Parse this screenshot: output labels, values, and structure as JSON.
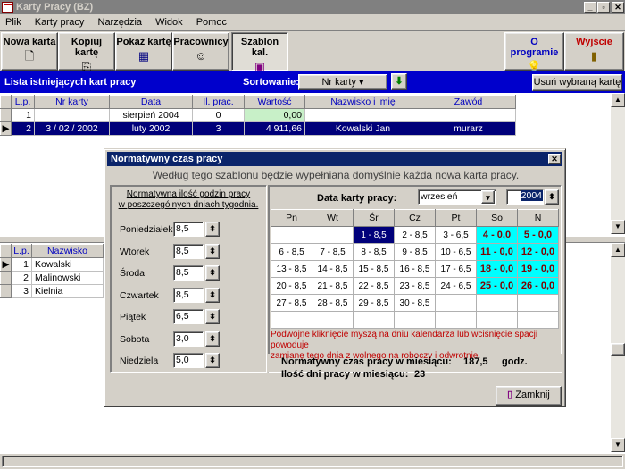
{
  "window": {
    "title": "Karty Pracy (BZ)"
  },
  "menu": [
    "Plik",
    "Karty pracy",
    "Narzędzia",
    "Widok",
    "Pomoc"
  ],
  "toolbar": {
    "new_card": "Nowa karta",
    "copy_card": "Kopiuj kartę",
    "show_card": "Pokaż kartę",
    "employees": "Pracownicy",
    "template": "Szablon kal.",
    "about": "O programie",
    "exit": "Wyjście"
  },
  "list_header": {
    "title": "Lista istniejących kart pracy",
    "sort_label": "Sortowanie:",
    "sort_value": "Nr karty",
    "delete_button": "Usuń wybraną kartę"
  },
  "cards_table": {
    "columns": [
      "L.p.",
      "Nr karty",
      "Data",
      "Il. prac.",
      "Wartość",
      "Nazwisko i imię",
      "Zawód"
    ],
    "rows": [
      [
        "1",
        "",
        "sierpień 2004",
        "0",
        "0,00",
        "",
        ""
      ],
      [
        "2",
        "3 / 02 / 2002",
        "luty 2002",
        "3",
        "4 911,66",
        "Kowalski Jan",
        "murarz"
      ]
    ]
  },
  "employees_table": {
    "columns": [
      "L.p.",
      "Nazwisko"
    ],
    "rows": [
      [
        "1",
        "Kowalski"
      ],
      [
        "2",
        "Malinowski"
      ],
      [
        "3",
        "Kielnia"
      ]
    ]
  },
  "dialog": {
    "title": "Normatywny czas pracy",
    "subtitle": "Według tego szablonu będzie wypełniana domyślnie każda nowa karta pracy.",
    "norm_heading_1": "Normatywna ilość godzin pracy",
    "norm_heading_2": "w poszczególnych dniach tygodnia.",
    "weekdays": [
      {
        "label": "Poniedziałek",
        "value": "8,5"
      },
      {
        "label": "Wtorek",
        "value": "8,5"
      },
      {
        "label": "Środa",
        "value": "8,5"
      },
      {
        "label": "Czwartek",
        "value": "8,5"
      },
      {
        "label": "Piątek",
        "value": "6,5"
      },
      {
        "label": "Sobota",
        "value": "3,0"
      },
      {
        "label": "Niedziela",
        "value": "5,0"
      }
    ],
    "date_label": "Data karty pracy:",
    "month": "wrzesień",
    "year": "2004",
    "calendar_headers": [
      "Pn",
      "Wt",
      "Śr",
      "Cz",
      "Pt",
      "So",
      "N"
    ],
    "calendar": [
      [
        "",
        "",
        "1 - 8,5",
        "2 - 8,5",
        "3 - 6,5",
        "4 - 0,0",
        "5 - 0,0"
      ],
      [
        "6 - 8,5",
        "7 - 8,5",
        "8 - 8,5",
        "9 - 8,5",
        "10 - 6,5",
        "11 - 0,0",
        "12 - 0,0"
      ],
      [
        "13 - 8,5",
        "14 - 8,5",
        "15 - 8,5",
        "16 - 8,5",
        "17 - 6,5",
        "18 - 0,0",
        "19 - 0,0"
      ],
      [
        "20 - 8,5",
        "21 - 8,5",
        "22 - 8,5",
        "23 - 8,5",
        "24 - 6,5",
        "25 - 0,0",
        "26 - 0,0"
      ],
      [
        "27 - 8,5",
        "28 - 8,5",
        "29 - 8,5",
        "30 - 8,5",
        "",
        "",
        ""
      ],
      [
        "",
        "",
        "",
        "",
        "",
        "",
        ""
      ]
    ],
    "hint_1": "Podwójne kliknięcie myszą na dniu kalendarza lub wciśnięcie spacji  powoduje",
    "hint_2": "zamianę  tego dnia z wolnego na roboczy i odwrotnie.",
    "monthly_hours_label": "Normatywny czas pracy w miesiącu:",
    "monthly_hours_value": "187,5",
    "monthly_hours_unit": "godz.",
    "work_days_label": "Ilość dni pracy w miesiącu:",
    "work_days_value": "23",
    "close_button": "Zamknij"
  },
  "colors": {
    "accent_blue": "#0000cc",
    "selection": "#00007a",
    "free_day": "#00ffff",
    "hint_text": "#c00000"
  }
}
